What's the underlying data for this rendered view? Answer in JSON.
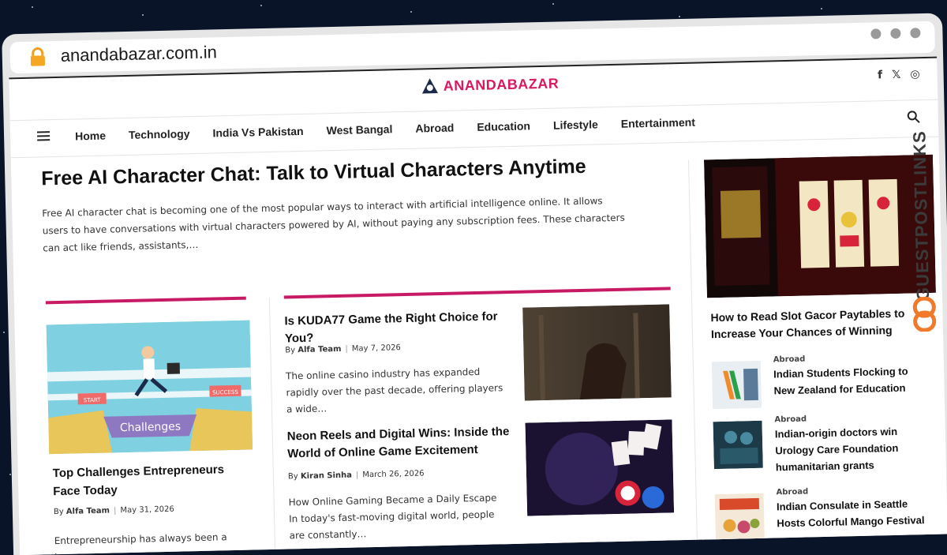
{
  "browser": {
    "url": "anandabazar.com.in"
  },
  "site": {
    "logo_text": "ANANDABAZAR",
    "brand_color": "#d8185f",
    "social_icons": [
      "facebook-icon",
      "x-icon",
      "instagram-icon"
    ]
  },
  "nav": {
    "items": [
      "Home",
      "Technology",
      "India Vs Pakistan",
      "West Bangal",
      "Abroad",
      "Education",
      "Lifestyle",
      "Entertainment"
    ]
  },
  "hero": {
    "title": "Free AI Character Chat: Talk to Virtual Characters Anytime",
    "excerpt": "Free AI character chat is becoming one of the most popular ways to interact with artificial intelligence online. It allows users to have conversations with virtual characters powered by AI, without paying any subscription fees. These characters can act like friends, assistants,…"
  },
  "featured": {
    "image_label": "Challenges",
    "sign_start": "START",
    "sign_success": "SUCCESS",
    "title": "Top Challenges Entrepreneurs Face Today",
    "by": "By",
    "author": "Alfa Team",
    "date": "May 31, 2026",
    "excerpt": "Entrepreneurship has always been a journey"
  },
  "articles": [
    {
      "title": "Is KUDA77 Game the Right Choice for You?",
      "by": "By",
      "author": "Alfa Team",
      "date": "May 7, 2026",
      "excerpt": "The online casino industry has expanded rapidly over the past decade, offering players a wide…"
    },
    {
      "title": "Neon Reels and Digital Wins: Inside the World of Online Game Excitement",
      "by": "By",
      "author": "Kiran Sinha",
      "date": "March 26, 2026",
      "excerpt": "How Online Gaming Became a Daily Escape In today's fast-moving digital world, people are constantly…"
    }
  ],
  "sidebar": {
    "main_title": "How to Read Slot Gacor Paytables to Increase Your Chances of Winning",
    "items": [
      {
        "category": "Abroad",
        "title": "Indian Students Flocking to New Zealand for Education"
      },
      {
        "category": "Abroad",
        "title": "Indian-origin doctors win Urology Care Foundation humanitarian grants"
      },
      {
        "category": "Abroad",
        "title": "Indian Consulate in Seattle Hosts Colorful Mango Festival"
      }
    ]
  },
  "watermark": {
    "text": "GUESTPOSTLINKS"
  }
}
